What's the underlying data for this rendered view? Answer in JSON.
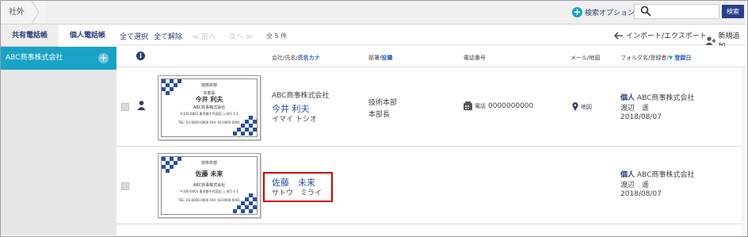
{
  "breadcrumb": {
    "label": "社外"
  },
  "search": {
    "option_label": "検索オプション",
    "placeholder": "",
    "button_label": "検索"
  },
  "tabs": [
    {
      "label": "共有電話帳"
    },
    {
      "label": "個人電話帳"
    }
  ],
  "sidebar": {
    "company": "ABC商事株式会社"
  },
  "toolbar": {
    "select_all": "全て選択",
    "deselect_all": "全て解除",
    "prev": "≪ 前へ",
    "next": "次へ ≫",
    "count": "全 5 件",
    "import_export": "インポート/エクスポート",
    "new_add": "新規追加"
  },
  "columns": {
    "company_name": "会社/氏名/",
    "name_kana": "氏名カナ",
    "dept": "部署/",
    "title": "役職",
    "phone": "電話番号",
    "mail_map": "メール/地図",
    "folder": "フォルダ名/登録者/",
    "reg_date": "登録日",
    "sort_mark": "▼"
  },
  "rows": [
    {
      "card": {
        "dept": "技術本部",
        "role": "本部長",
        "name": "今井 利夫",
        "company": "ABC商事株式会社",
        "address": "〒100-0001 東京都千代田区○○町1-1-1",
        "tel": "TEL: 03-0000-0000  FAX: 03-0000-0001"
      },
      "company": "ABC商事株式会社",
      "name": "今井 利夫",
      "kana": "イマイ トシオ",
      "dept": "技術本部",
      "title": "本部長",
      "phone_label": "電話",
      "phone": "0000000000",
      "map_label": "地図",
      "folder_tag": "個人",
      "folder": "ABC商事株式会社",
      "owner": "渡辺　遥",
      "date": "2018/08/07"
    },
    {
      "card": {
        "dept": "技術本部",
        "role": "",
        "name": "佐藤 未来",
        "company": "ABC商事株式会社",
        "address": "〒100-0001 東京都千代田区○○町1-1-1",
        "tel": "TEL: 03-0000-0000  FAX: 03-0000-0001"
      },
      "company": "",
      "name": "佐藤　未来",
      "kana": "サトウ　ミライ",
      "dept": "",
      "title": "",
      "phone_label": "",
      "phone": "",
      "map_label": "",
      "folder_tag": "個人",
      "folder": "ABC商事株式会社",
      "owner": "渡辺　遥",
      "date": "2018/08/07"
    }
  ],
  "colors": {
    "accent": "#1aa3c6",
    "navy": "#2a3f8a",
    "link": "#2a4fb0",
    "highlight": "#d40000"
  }
}
